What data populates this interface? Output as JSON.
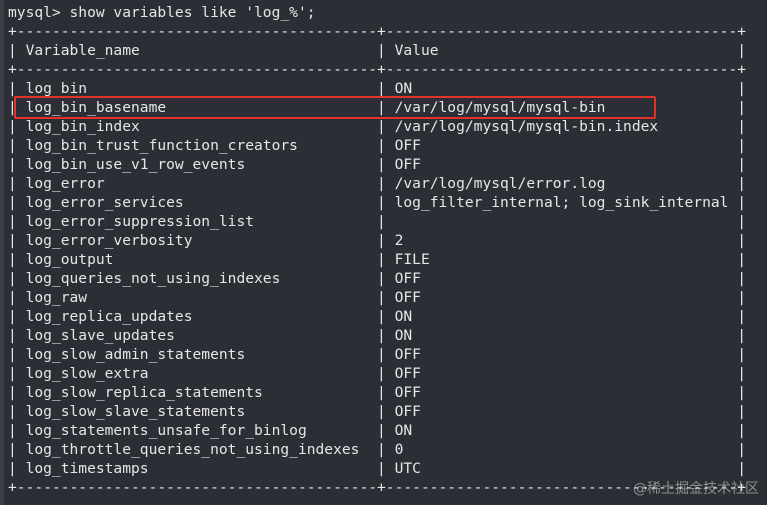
{
  "prompt_line": "mysql> show variables like 'log_%';",
  "border_line": "+-----------------------------------------+----------------------------------------+",
  "header": {
    "col1": "Variable_name",
    "col2": "Value"
  },
  "rows": [
    {
      "name": "log_bin",
      "value": "ON"
    },
    {
      "name": "log_bin_basename",
      "value": "/var/log/mysql/mysql-bin"
    },
    {
      "name": "log_bin_index",
      "value": "/var/log/mysql/mysql-bin.index"
    },
    {
      "name": "log_bin_trust_function_creators",
      "value": "OFF"
    },
    {
      "name": "log_bin_use_v1_row_events",
      "value": "OFF"
    },
    {
      "name": "log_error",
      "value": "/var/log/mysql/error.log"
    },
    {
      "name": "log_error_services",
      "value": "log_filter_internal; log_sink_internal"
    },
    {
      "name": "log_error_suppression_list",
      "value": ""
    },
    {
      "name": "log_error_verbosity",
      "value": "2"
    },
    {
      "name": "log_output",
      "value": "FILE"
    },
    {
      "name": "log_queries_not_using_indexes",
      "value": "OFF"
    },
    {
      "name": "log_raw",
      "value": "OFF"
    },
    {
      "name": "log_replica_updates",
      "value": "ON"
    },
    {
      "name": "log_slave_updates",
      "value": "ON"
    },
    {
      "name": "log_slow_admin_statements",
      "value": "OFF"
    },
    {
      "name": "log_slow_extra",
      "value": "OFF"
    },
    {
      "name": "log_slow_replica_statements",
      "value": "OFF"
    },
    {
      "name": "log_slow_slave_statements",
      "value": "OFF"
    },
    {
      "name": "log_statements_unsafe_for_binlog",
      "value": "ON"
    },
    {
      "name": "log_throttle_queries_not_using_indexes",
      "value": "0"
    },
    {
      "name": "log_timestamps",
      "value": "UTC"
    }
  ],
  "highlighted_row": "log_bin_basename",
  "watermark": "@稀土掘金技术社区",
  "colors": {
    "background": "#2b2f35",
    "text": "#e6e6e6",
    "highlight_box": "#e0342a"
  }
}
